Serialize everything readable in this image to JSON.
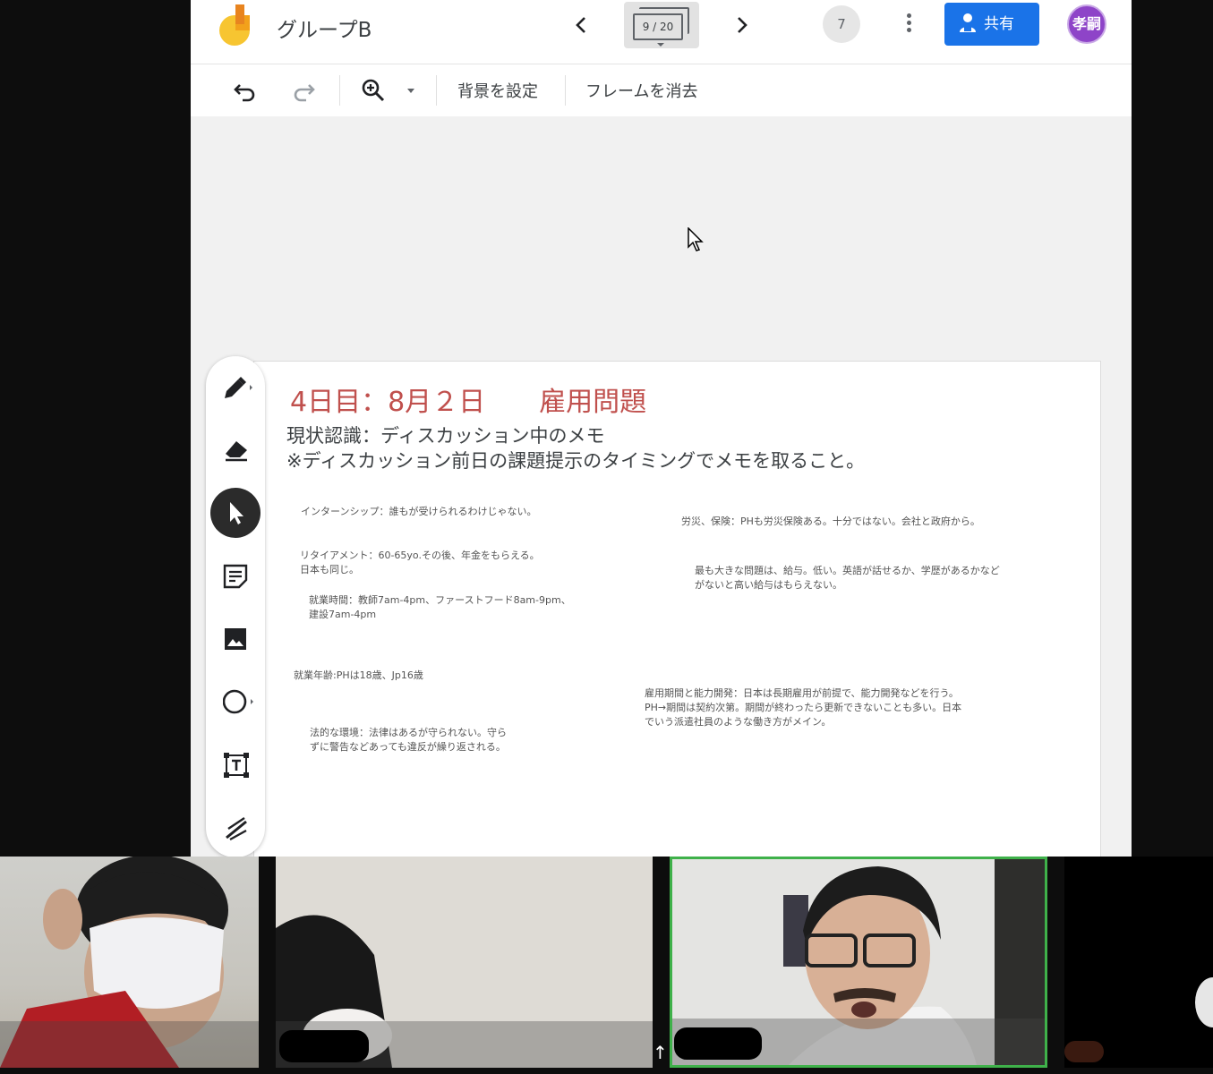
{
  "header": {
    "title": "グループB",
    "frame_counter": "9 / 20",
    "collaborator_count": "7",
    "share_label": "共有",
    "avatar_text": "孝嗣"
  },
  "toolbar": {
    "set_background": "背景を設定",
    "clear_frame": "フレームを消去"
  },
  "slide": {
    "title": "4日目：8月２日　　雇用問題",
    "subtitle_line1": "現状認識：ディスカッション中のメモ",
    "subtitle_line2": "※ディスカッション前日の課題提示のタイミングでメモを取ること。",
    "notes": [
      "インターンシップ：誰もが受けられるわけじゃない。",
      "リタイアメント：60-65yo.その後、年金をもらえる。\n日本も同じ。",
      "就業時間：教師7am-4pm、ファーストフード8am-9pm、\n建設7am-4pm",
      "就業年齢:PHは18歳、Jp16歳",
      "法的な環境：法律はあるが守られない。守ら\nずに警告などあっても違反が繰り返される。",
      "労災、保険：PHも労災保険ある。十分ではない。会社と政府から。",
      "最も大きな問題は、給与。低い。英語が話せるか、学歴があるかなど\nがないと高い給与はもらえない。",
      "雇用期間と能力開発：日本は長期雇用が前提で、能力開発などを行う。\nPH→期間は契約次第。期間が終わったら更新できないことも多い。日本\nでいう派遣社員のような働き方がメイン。"
    ]
  },
  "tools": [
    "pen-icon",
    "eraser-icon",
    "select-arrow-icon",
    "sticky-note-icon",
    "image-icon",
    "circle-shape-icon",
    "text-box-icon",
    "laser-pointer-icon"
  ],
  "colors": {
    "accent_blue": "#1a73e8",
    "title_red": "#c0504d",
    "active_speaker_border": "#3fb14a"
  }
}
